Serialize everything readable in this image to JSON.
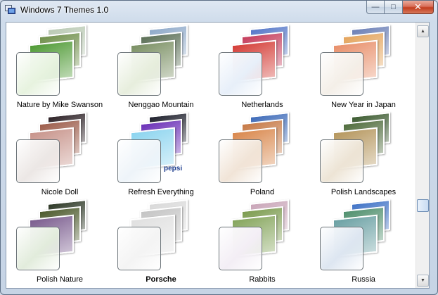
{
  "window": {
    "title": "Windows 7 Themes 1.0"
  },
  "caption": {
    "minimize": "—",
    "maximize": "□",
    "close": "✕"
  },
  "themes": [
    {
      "label": "Nature by Mike Swanson",
      "bold": false,
      "colors": [
        "#b9c9b3",
        "#6f8f4a",
        "#4f9a35"
      ],
      "glass_tint": "#e7f3df"
    },
    {
      "label": "Nenggao Mountain",
      "bold": false,
      "colors": [
        "#8ea9c9",
        "#5a6e55",
        "#7a8f63"
      ],
      "glass_tint": "#e7eedd"
    },
    {
      "label": "Netherlands",
      "bold": false,
      "colors": [
        "#5577c8",
        "#c53c5b",
        "#d43d37"
      ],
      "glass_tint": "#e7eff9"
    },
    {
      "label": "New Year in Japan",
      "bold": false,
      "colors": [
        "#6b7fb6",
        "#e4a45c",
        "#e88f6a"
      ],
      "glass_tint": "#f4efe8"
    },
    {
      "label": "Nicole Doll",
      "bold": false,
      "colors": [
        "#2b2025",
        "#9c5c4a",
        "#c7938a"
      ],
      "glass_tint": "#ece7e5"
    },
    {
      "label": "Refresh Everything",
      "bold": false,
      "colors": [
        "#1d1f2b",
        "#6a2fb7",
        "#8bd4ef"
      ],
      "glass_tint": "#eef4f9"
    },
    {
      "label": "Poland",
      "bold": false,
      "colors": [
        "#3d6ab8",
        "#c67844",
        "#d9874c"
      ],
      "glass_tint": "#f1e4d7"
    },
    {
      "label": "Polish Landscapes",
      "bold": false,
      "colors": [
        "#3b5a2f",
        "#4f6c3c",
        "#b5965d"
      ],
      "glass_tint": "#ede4d5"
    },
    {
      "label": "Polish Nature",
      "bold": false,
      "colors": [
        "#2b3624",
        "#4c5a2c",
        "#7a5c8e"
      ],
      "glass_tint": "#e2ecdc"
    },
    {
      "label": "Porsche",
      "bold": true,
      "colors": [
        "#d9d9d9",
        "#c4c4c4",
        "#e0e0e0"
      ],
      "glass_tint": "#f4f4f4"
    },
    {
      "label": "Rabbits",
      "bold": false,
      "colors": [
        "#c9a5b8",
        "#7b9b4e",
        "#85a55c"
      ],
      "glass_tint": "#f3eef5"
    },
    {
      "label": "Russia",
      "bold": false,
      "colors": [
        "#3f72c6",
        "#4f8f6d",
        "#6aa0a3"
      ],
      "glass_tint": "#dde6f1"
    }
  ],
  "badges": {
    "pepsi": "pepsi"
  }
}
